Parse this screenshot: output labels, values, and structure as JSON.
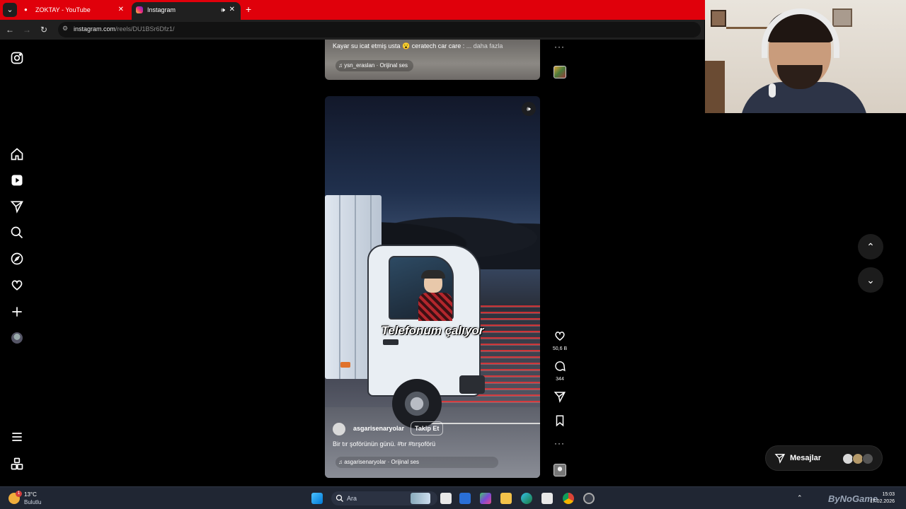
{
  "browser": {
    "tabs": [
      {
        "title": "ZOKTAY - YouTube",
        "active": false
      },
      {
        "title": "Instagram",
        "active": true
      }
    ],
    "new_tab_label": "+",
    "url_host": "instagram.com",
    "url_path": "/reels/DU1BSr6Dfz1/"
  },
  "reels": {
    "previous": {
      "caption": "Kayar su icat etmiş usta 😮 ceratech car care :",
      "more_label": "... daha fazla",
      "audio": "ysn_eraslan · Orijinal ses"
    },
    "current": {
      "overlay_text": "Telefonum çalıyor",
      "username": "asgarisenaryolar",
      "follow_label": "Takip Et",
      "description": "Bir tır şoförünün günü. #tır #tırşoförü",
      "audio": "asgarisenaryolar · Orijinal ses"
    }
  },
  "actions": {
    "likes": "50,6 B",
    "comments": "344"
  },
  "messages": {
    "label": "Mesajlar"
  },
  "taskbar": {
    "weather_temp": "13°C",
    "weather_desc": "Bulutlu",
    "weather_badge": "1",
    "search_label": "Ara",
    "tray_brand": "ByNoGame",
    "clock_time": "15:03",
    "clock_date": "17.02.2026"
  },
  "colors": {
    "tabbar": "#e0000b",
    "page_bg": "#000000",
    "taskbar": "#202633"
  }
}
